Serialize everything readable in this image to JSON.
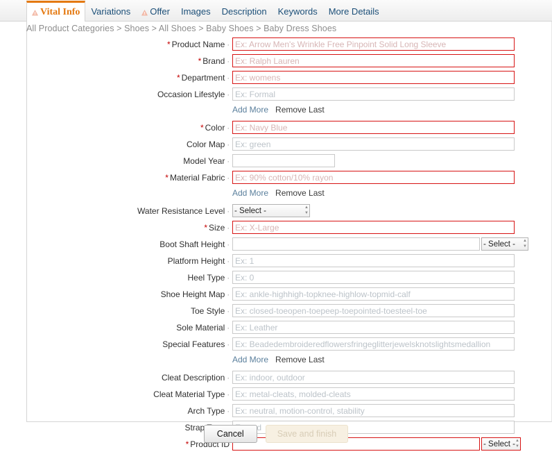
{
  "tabs": [
    {
      "label": "Vital Info",
      "active": true,
      "warn": true,
      "name": "tab-vital-info"
    },
    {
      "label": "Variations",
      "active": false,
      "warn": false,
      "name": "tab-variations"
    },
    {
      "label": "Offer",
      "active": false,
      "warn": true,
      "name": "tab-offer"
    },
    {
      "label": "Images",
      "active": false,
      "warn": false,
      "name": "tab-images"
    },
    {
      "label": "Description",
      "active": false,
      "warn": false,
      "name": "tab-description"
    },
    {
      "label": "Keywords",
      "active": false,
      "warn": false,
      "name": "tab-keywords"
    },
    {
      "label": "More Details",
      "active": false,
      "warn": false,
      "name": "tab-more-details"
    }
  ],
  "breadcrumb": "All Product Categories > Shoes > All Shoes > Baby Shoes > Baby Dress Shoes",
  "select_default": "- Select -",
  "add_more_label": "Add More",
  "remove_last_label": "Remove Last",
  "colors": {
    "accent_orange": "#e47911",
    "required_red": "#d71313",
    "star_red": "#c40000",
    "link_blue": "#5a7f9c",
    "breadcrumb_gray": "#8d8d8d",
    "placeholder_gray": "#bcc3c9",
    "disabled_btn_bg": "#f7f0e2"
  },
  "fields": [
    {
      "label": "Product Name",
      "required": true,
      "dot": true,
      "placeholder": "Ex: Arrow Men's Wrinkle Free Pinpoint Solid Long Sleeve",
      "value": "",
      "name": "product-name-field"
    },
    {
      "label": "Brand",
      "required": true,
      "dot": true,
      "placeholder": "Ex: Ralph Lauren",
      "value": "",
      "name": "brand-field"
    },
    {
      "label": "Department",
      "required": true,
      "dot": true,
      "placeholder": "Ex: womens",
      "value": "",
      "name": "department-field"
    },
    {
      "label": "Occasion Lifestyle",
      "required": false,
      "dot": true,
      "placeholder": "Ex: Formal",
      "value": "",
      "name": "occasion-lifestyle-field",
      "addmore": true
    },
    {
      "label": "Color",
      "required": true,
      "dot": true,
      "placeholder": "Ex: Navy Blue",
      "value": "",
      "name": "color-field"
    },
    {
      "label": "Color Map",
      "required": false,
      "dot": true,
      "placeholder": "Ex: green",
      "value": "",
      "name": "color-map-field"
    },
    {
      "label": "Model Year",
      "required": false,
      "dot": true,
      "placeholder": "",
      "value": "",
      "name": "model-year-field",
      "width": "short"
    },
    {
      "label": "Material Fabric",
      "required": true,
      "dot": true,
      "placeholder": "Ex: 90% cotton/10% rayon",
      "value": "",
      "name": "material-fabric-field",
      "addmore": true
    },
    {
      "label": "Water Resistance Level",
      "required": false,
      "dot": true,
      "select_only": true,
      "select_value": "- Select -",
      "name": "water-resistance-level-select"
    },
    {
      "label": "Size",
      "required": true,
      "dot": true,
      "placeholder": "Ex: X-Large",
      "value": "",
      "name": "size-field"
    },
    {
      "label": "Boot Shaft Height",
      "required": false,
      "dot": true,
      "placeholder": "",
      "value": "",
      "name": "boot-shaft-height-field",
      "trailing_select": true,
      "select_value": "- Select -"
    },
    {
      "label": "Platform Height",
      "required": false,
      "dot": true,
      "placeholder": "Ex: 1",
      "value": "",
      "name": "platform-height-field"
    },
    {
      "label": "Heel Type",
      "required": false,
      "dot": true,
      "placeholder": "Ex: 0",
      "value": "",
      "name": "heel-type-field"
    },
    {
      "label": "Shoe Height Map",
      "required": false,
      "dot": true,
      "placeholder": "Ex: ankle-highhigh-topknee-highlow-topmid-calf",
      "value": "",
      "name": "shoe-height-map-field"
    },
    {
      "label": "Toe Style",
      "required": false,
      "dot": true,
      "placeholder": "Ex: closed-toeopen-toepeep-toepointed-toesteel-toe",
      "value": "",
      "name": "toe-style-field"
    },
    {
      "label": "Sole Material",
      "required": false,
      "dot": true,
      "placeholder": "Ex: Leather",
      "value": "",
      "name": "sole-material-field"
    },
    {
      "label": "Special Features",
      "required": false,
      "dot": true,
      "placeholder": "Ex: Beadedembroideredflowersfringeglitterjewelsknotslightsmedallion",
      "value": "",
      "name": "special-features-field",
      "addmore": true
    },
    {
      "label": "Cleat Description",
      "required": false,
      "dot": true,
      "placeholder": "Ex: indoor, outdoor",
      "value": "",
      "name": "cleat-description-field"
    },
    {
      "label": "Cleat Material Type",
      "required": false,
      "dot": true,
      "placeholder": "Ex: metal-cleats, molded-cleats",
      "value": "",
      "name": "cleat-material-type-field"
    },
    {
      "label": "Arch Type",
      "required": false,
      "dot": true,
      "placeholder": "Ex: neutral, motion-control, stability",
      "value": "",
      "name": "arch-type-field"
    },
    {
      "label": "Strap Type",
      "required": false,
      "dot": true,
      "placeholder": "Ex: red",
      "value": "",
      "name": "strap-type-field"
    },
    {
      "label": "Product ID",
      "required": true,
      "dot": false,
      "placeholder": "",
      "value": "",
      "name": "product-id-field",
      "trailing_select": true,
      "select_value": "- Select -",
      "select_required": true,
      "width": "mid"
    }
  ],
  "footer": {
    "cancel_label": "Cancel",
    "save_label": "Save and finish",
    "save_disabled": true
  }
}
